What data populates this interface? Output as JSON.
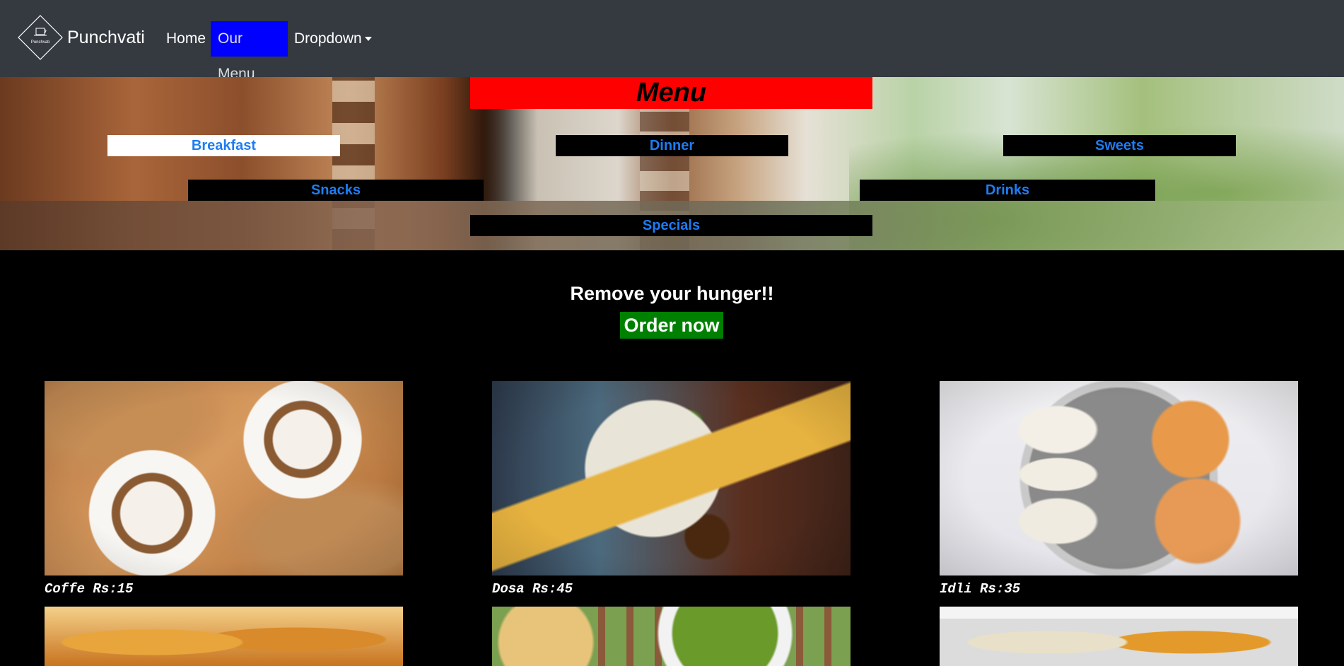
{
  "navbar": {
    "brand": "Punchvati",
    "logo_text": "Punchvati",
    "links": [
      {
        "label": "Home",
        "active": false
      },
      {
        "label": "Our Menu",
        "active": true
      },
      {
        "label": "Dropdown",
        "active": false
      }
    ]
  },
  "hero": {
    "title": "Menu",
    "categories": [
      {
        "label": "Breakfast",
        "active": true
      },
      {
        "label": "Dinner",
        "active": false
      },
      {
        "label": "Sweets",
        "active": false
      },
      {
        "label": "Snacks",
        "active": false
      },
      {
        "label": "Drinks",
        "active": false
      },
      {
        "label": "Specials",
        "active": false
      }
    ]
  },
  "cta": {
    "tagline": "Remove your hunger!!",
    "button": "Order now"
  },
  "menu_items": [
    {
      "label": "Coffe Rs:15",
      "image": "coffee-photo"
    },
    {
      "label": "Dosa Rs:45",
      "image": "dosa-photo"
    },
    {
      "label": "Idli Rs:35",
      "image": "idli-photo"
    },
    {
      "label": "",
      "image": "pav-photo"
    },
    {
      "label": "",
      "image": "pani-puri-photo"
    },
    {
      "label": "",
      "image": "chutney-photo"
    }
  ],
  "colors": {
    "navbar_bg": "#343a40",
    "active_nav_bg": "#0000ff",
    "menu_title_bg": "#ff0000",
    "category_text": "#1e7cf2",
    "order_button_bg": "#008000",
    "page_bg": "#000000"
  }
}
